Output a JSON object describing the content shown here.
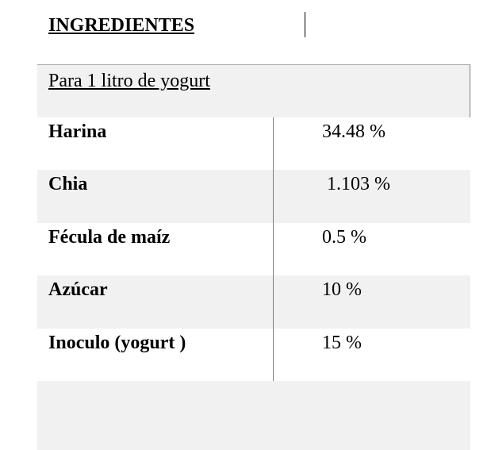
{
  "document": {
    "heading": "INGREDIENTES",
    "subheading": "Para 1 litro de yogurt",
    "rows": [
      {
        "name": "Harina",
        "value": "34.48 %"
      },
      {
        "name": "Chia",
        "value": " 1.103 %"
      },
      {
        "name": "Fécula de maíz",
        "value": "0.5 %"
      },
      {
        "name": "Azúcar",
        "value": "10 %"
      },
      {
        "name": "Inoculo (yogurt )",
        "value": "15 %"
      }
    ]
  },
  "colors": {
    "shade": "#f1f1f1",
    "border": "#7f7f7f",
    "text": "#000000"
  }
}
